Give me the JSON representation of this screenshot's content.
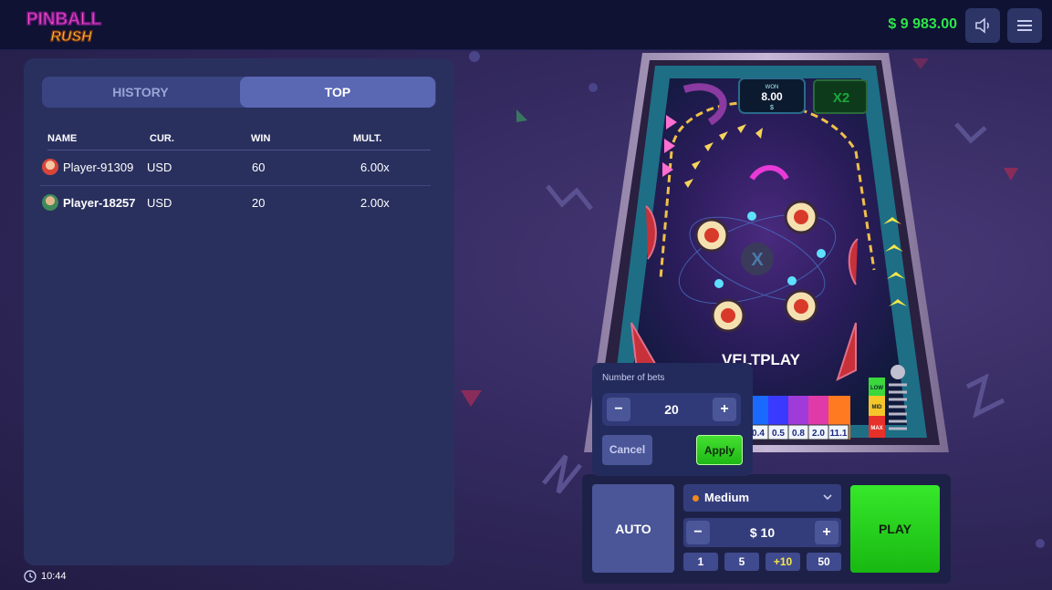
{
  "header": {
    "logo_line1": "PINBALL",
    "logo_line2": "RUSH",
    "balance": "$ 9 983.00",
    "sound_icon": "speaker-icon",
    "menu_icon": "hamburger-menu-icon"
  },
  "leaderboard": {
    "tabs": [
      "HISTORY",
      "TOP"
    ],
    "active_tab": "TOP",
    "columns": [
      "NAME",
      "CUR.",
      "WIN",
      "MULT."
    ],
    "rows": [
      {
        "name": "Player-91309",
        "currency": "USD",
        "win": "60",
        "mult": "6.00x"
      },
      {
        "name": "Player-18257",
        "currency": "USD",
        "win": "20",
        "mult": "2.00x"
      }
    ]
  },
  "clock": {
    "time": "10:44"
  },
  "board": {
    "won_label": "WON",
    "won_value": "8.00",
    "won_currency": "$",
    "multiplier_badge": "X2",
    "brand": "VELTPLAY",
    "buckets": [
      "0.4",
      "0.5",
      "0.8",
      "2.0",
      "11.1"
    ],
    "risk_levels": [
      "LOW",
      "MID",
      "MAX"
    ]
  },
  "auto_popup": {
    "label": "Number of bets",
    "value": "20",
    "minus": "−",
    "plus": "+",
    "cancel": "Cancel",
    "apply": "Apply"
  },
  "controls": {
    "auto": "AUTO",
    "risk": "Medium",
    "bet_value": "$ 10",
    "minus": "−",
    "plus": "+",
    "quick_bets": [
      "1",
      "5",
      "+10",
      "50"
    ],
    "play": "PLAY"
  },
  "colors": {
    "balance": "#2ee64a",
    "play": "#22cc18",
    "panel": "#29305e",
    "topbar": "#0f1233"
  }
}
